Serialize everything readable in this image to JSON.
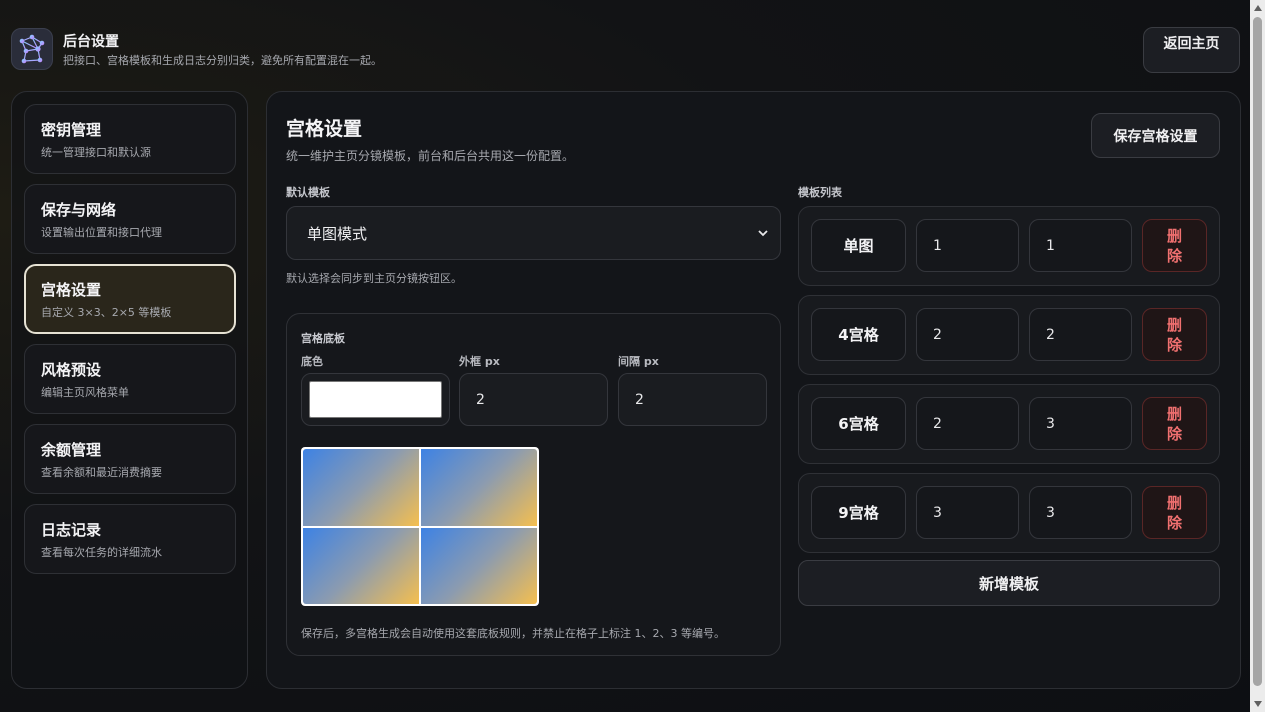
{
  "header": {
    "title": "后台设置",
    "subtitle": "把接口、宫格模板和生成日志分别归类，避免所有配置混在一起。",
    "back_label": "返回主页",
    "logo_icon": "network-graph-icon"
  },
  "sidebar": {
    "items": [
      {
        "label": "密钥管理",
        "desc": "统一管理接口和默认源",
        "active": false
      },
      {
        "label": "保存与网络",
        "desc": "设置输出位置和接口代理",
        "active": false
      },
      {
        "label": "宫格设置",
        "desc": "自定义 3×3、2×5 等模板",
        "active": true
      },
      {
        "label": "风格预设",
        "desc": "编辑主页风格菜单",
        "active": false
      },
      {
        "label": "余额管理",
        "desc": "查看余额和最近消费摘要",
        "active": false
      },
      {
        "label": "日志记录",
        "desc": "查看每次任务的详细流水",
        "active": false
      }
    ]
  },
  "main": {
    "title": "宫格设置",
    "subtitle": "统一维护主页分镜模板，前台和后台共用这一份配置。",
    "save_label": "保存宫格设置",
    "default_label": "默认模板",
    "default_value": "单图模式",
    "default_hint": "默认选择会同步到主页分镜按钮区。",
    "panel": {
      "title": "宫格底板",
      "bg_label": "底色",
      "bg_color": "#ffffff",
      "border_label": "外框 px",
      "border_value": "2",
      "gap_label": "间隔 px",
      "gap_value": "2",
      "note": "保存后，多宫格生成会自动使用这套底板规则，并禁止在格子上标注 1、2、3 等编号。"
    },
    "template_list_label": "模板列表",
    "templates": [
      {
        "name": "单图",
        "rows": "1",
        "cols": "1",
        "delete_label": "删除"
      },
      {
        "name": "4宫格",
        "rows": "2",
        "cols": "2",
        "delete_label": "删除"
      },
      {
        "name": "6宫格",
        "rows": "2",
        "cols": "3",
        "delete_label": "删除"
      },
      {
        "name": "9宫格",
        "rows": "3",
        "cols": "3",
        "delete_label": "删除"
      }
    ],
    "add_label": "新增模板"
  },
  "colors": {
    "accent_active_border": "#e6e2d4",
    "delete_text": "#f07070",
    "preview_gradient_start": "#3d82e4",
    "preview_gradient_end": "#f5bf4f"
  }
}
